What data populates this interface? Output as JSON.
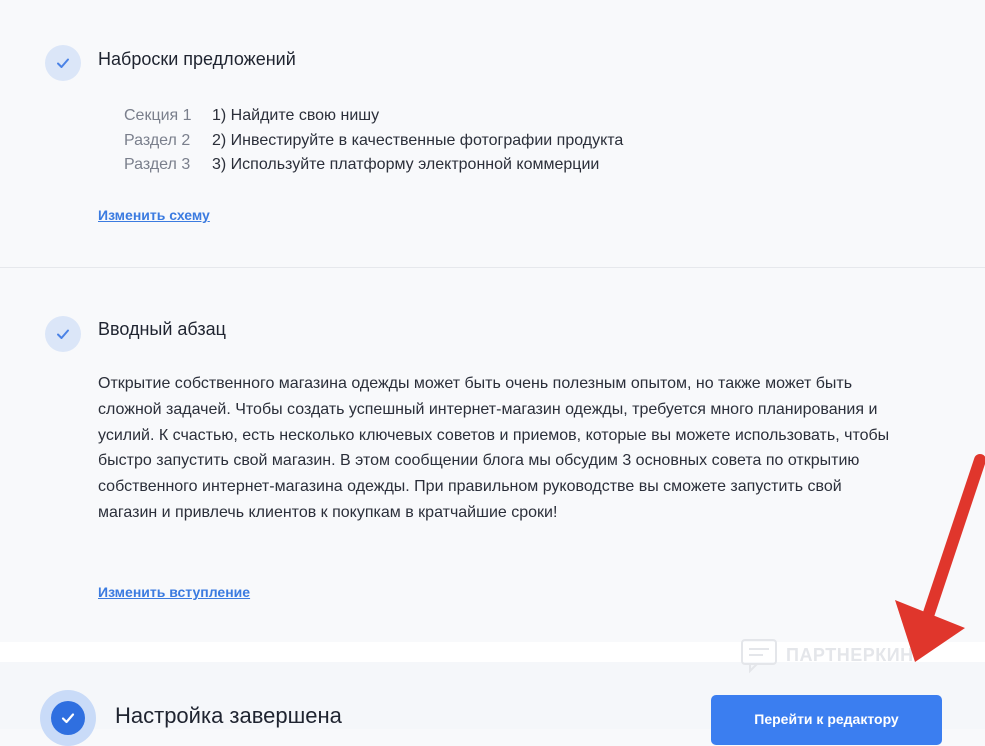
{
  "outline": {
    "title": "Наброски предложений",
    "rows": [
      {
        "label": "Секция 1",
        "text": "1) Найдите свою нишу"
      },
      {
        "label": "Раздел 2",
        "text": "2) Инвестируйте в качественные фотографии продукта"
      },
      {
        "label": "Раздел 3",
        "text": "3) Используйте платформу электронной коммерции"
      }
    ],
    "edit_link": "Изменить схему"
  },
  "intro": {
    "title": "Вводный абзац",
    "text": "Открытие собственного магазина одежды может быть очень полезным опытом, но также может быть сложной задачей. Чтобы создать успешный интернет-магазин одежды, требуется много планирования и усилий. К счастью, есть несколько ключевых советов и приемов, которые вы можете использовать, чтобы быстро запустить свой магазин. В этом сообщении блога мы обсудим 3 основных совета по открытию собственного интернет-магазина одежды. При правильном руководстве вы сможете запустить свой магазин и привлечь клиентов к покупкам в кратчайшие сроки!",
    "edit_link": "Изменить вступление"
  },
  "footer": {
    "status": "Настройка завершена",
    "button": "Перейти к редактору"
  },
  "watermark": "ПАРТНЕРКИН",
  "colors": {
    "accent": "#3b7ef0",
    "link": "#3b7be0",
    "arrow": "#e0362c",
    "check_bg": "#dbe6f8"
  },
  "icons": [
    "check-icon",
    "watermark-logo-icon",
    "red-arrow-annotation"
  ]
}
